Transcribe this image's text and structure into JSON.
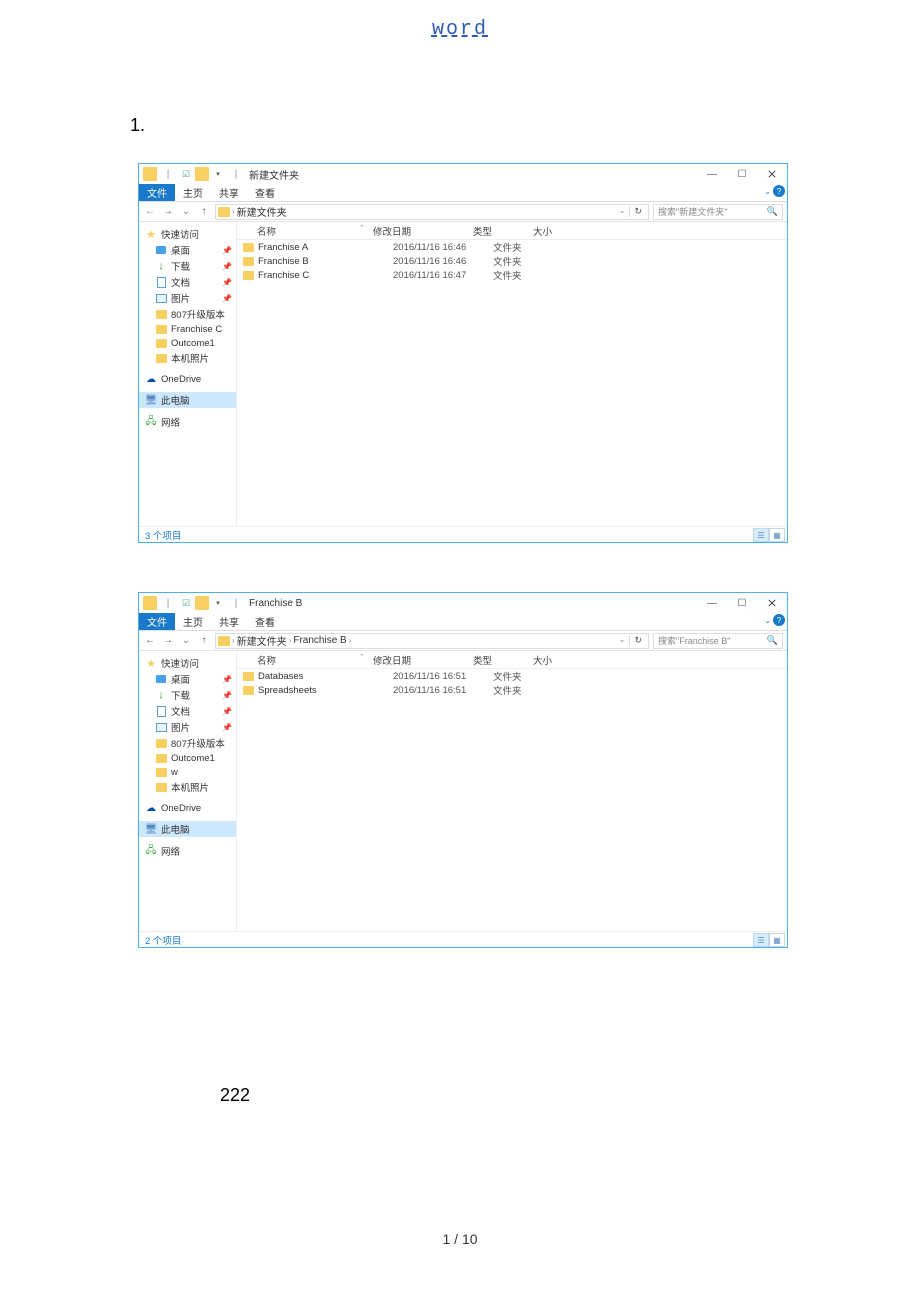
{
  "doc": {
    "header_link": "word",
    "section1": "1.",
    "section222": "222",
    "page_footer": "1 / 10"
  },
  "explorer1": {
    "title": "新建文件夹",
    "tabs": {
      "file": "文件",
      "home": "主页",
      "share": "共享",
      "view": "查看"
    },
    "breadcrumb": {
      "root_sep": "›",
      "items": [
        "新建文件夹"
      ]
    },
    "search_placeholder": "搜索\"新建文件夹\"",
    "columns": {
      "name": "名称",
      "date": "修改日期",
      "type": "类型",
      "size": "大小"
    },
    "sidebar": {
      "quick": "快速访问",
      "desktop": "桌面",
      "downloads": "下载",
      "documents": "文档",
      "pictures": "图片",
      "f807": "807升级版本",
      "franc": "Franchise C",
      "outcome": "Outcome1",
      "localpic": "本机照片",
      "onedrive": "OneDrive",
      "thispc": "此电脑",
      "network": "网络"
    },
    "rows": [
      {
        "name": "Franchise A",
        "date": "2016/11/16 16:46",
        "type": "文件夹"
      },
      {
        "name": "Franchise B",
        "date": "2016/11/16 16:46",
        "type": "文件夹"
      },
      {
        "name": "Franchise C",
        "date": "2016/11/16 16:47",
        "type": "文件夹"
      }
    ],
    "status": "3 个项目"
  },
  "explorer2": {
    "title": "Franchise B",
    "tabs": {
      "file": "文件",
      "home": "主页",
      "share": "共享",
      "view": "查看"
    },
    "breadcrumb": {
      "root_sep": "›",
      "items": [
        "新建文件夹",
        "Franchise B"
      ]
    },
    "search_placeholder": "搜索\"Franchise B\"",
    "columns": {
      "name": "名称",
      "date": "修改日期",
      "type": "类型",
      "size": "大小"
    },
    "sidebar": {
      "quick": "快速访问",
      "desktop": "桌面",
      "downloads": "下载",
      "documents": "文档",
      "pictures": "图片",
      "f807": "807升级版本",
      "outcome": "Outcome1",
      "w": "w",
      "localpic": "本机照片",
      "onedrive": "OneDrive",
      "thispc": "此电脑",
      "network": "网络"
    },
    "rows": [
      {
        "name": "Databases",
        "date": "2016/11/16 16:51",
        "type": "文件夹"
      },
      {
        "name": "Spreadsheets",
        "date": "2016/11/16 16:51",
        "type": "文件夹"
      }
    ],
    "status": "2 个项目"
  }
}
